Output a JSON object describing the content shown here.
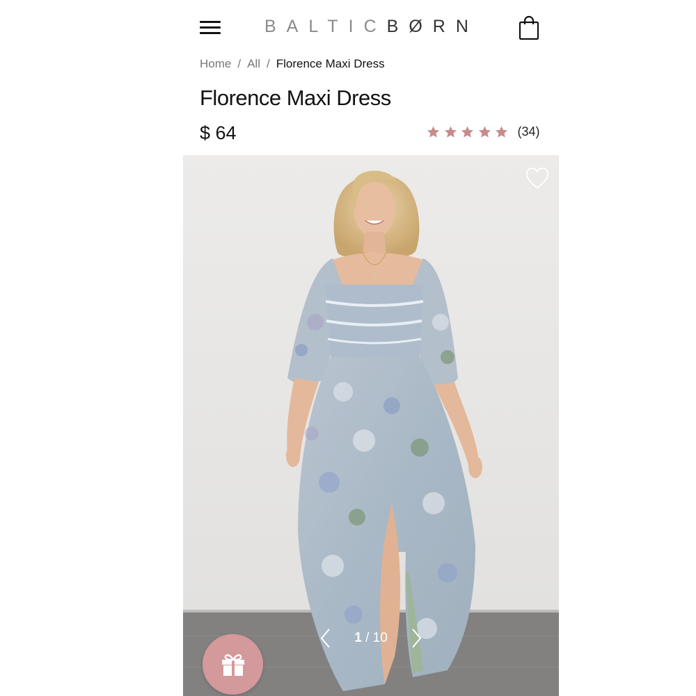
{
  "header": {
    "menu_icon": "hamburger-menu-icon",
    "brand_light": "BALTIC",
    "brand_dark": "BØRN",
    "cart_icon": "shopping-bag-icon"
  },
  "breadcrumb": {
    "items": [
      "Home",
      "All"
    ],
    "separator": "/",
    "current": "Florence Maxi Dress"
  },
  "product": {
    "title": "Florence Maxi Dress",
    "price": "$ 64",
    "rating": 5,
    "rating_max": 5,
    "review_count": "(34)",
    "wishlist_icon": "heart-outline-icon"
  },
  "gallery": {
    "current": "1",
    "separator": "/",
    "total": "10",
    "prev_icon": "chevron-left-icon",
    "next_icon": "chevron-right-icon"
  },
  "gift": {
    "icon": "gift-icon"
  },
  "colors": {
    "star": "#c98a8c",
    "gift_button": "#d4999b"
  }
}
